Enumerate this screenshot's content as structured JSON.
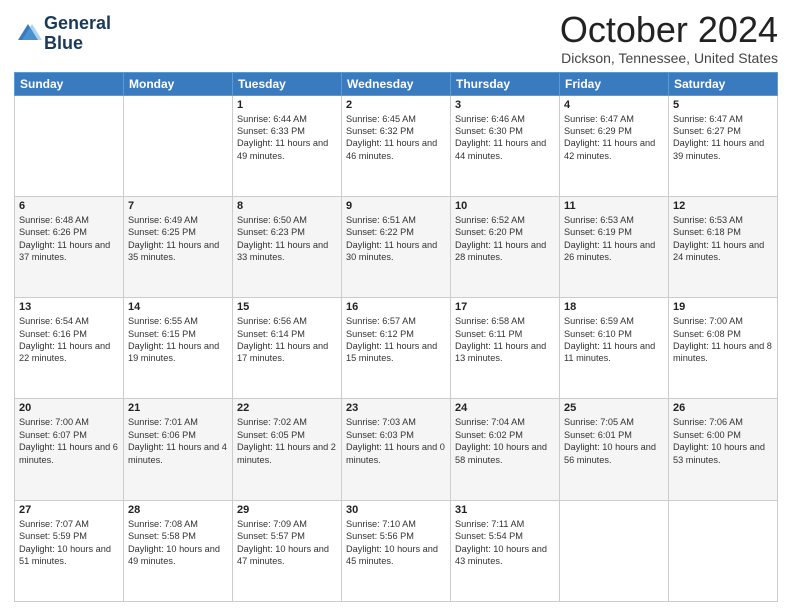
{
  "header": {
    "logo_line1": "General",
    "logo_line2": "Blue",
    "month": "October 2024",
    "location": "Dickson, Tennessee, United States"
  },
  "days_of_week": [
    "Sunday",
    "Monday",
    "Tuesday",
    "Wednesday",
    "Thursday",
    "Friday",
    "Saturday"
  ],
  "weeks": [
    [
      {
        "day": "",
        "sunrise": "",
        "sunset": "",
        "daylight": ""
      },
      {
        "day": "",
        "sunrise": "",
        "sunset": "",
        "daylight": ""
      },
      {
        "day": "1",
        "sunrise": "Sunrise: 6:44 AM",
        "sunset": "Sunset: 6:33 PM",
        "daylight": "Daylight: 11 hours and 49 minutes."
      },
      {
        "day": "2",
        "sunrise": "Sunrise: 6:45 AM",
        "sunset": "Sunset: 6:32 PM",
        "daylight": "Daylight: 11 hours and 46 minutes."
      },
      {
        "day": "3",
        "sunrise": "Sunrise: 6:46 AM",
        "sunset": "Sunset: 6:30 PM",
        "daylight": "Daylight: 11 hours and 44 minutes."
      },
      {
        "day": "4",
        "sunrise": "Sunrise: 6:47 AM",
        "sunset": "Sunset: 6:29 PM",
        "daylight": "Daylight: 11 hours and 42 minutes."
      },
      {
        "day": "5",
        "sunrise": "Sunrise: 6:47 AM",
        "sunset": "Sunset: 6:27 PM",
        "daylight": "Daylight: 11 hours and 39 minutes."
      }
    ],
    [
      {
        "day": "6",
        "sunrise": "Sunrise: 6:48 AM",
        "sunset": "Sunset: 6:26 PM",
        "daylight": "Daylight: 11 hours and 37 minutes."
      },
      {
        "day": "7",
        "sunrise": "Sunrise: 6:49 AM",
        "sunset": "Sunset: 6:25 PM",
        "daylight": "Daylight: 11 hours and 35 minutes."
      },
      {
        "day": "8",
        "sunrise": "Sunrise: 6:50 AM",
        "sunset": "Sunset: 6:23 PM",
        "daylight": "Daylight: 11 hours and 33 minutes."
      },
      {
        "day": "9",
        "sunrise": "Sunrise: 6:51 AM",
        "sunset": "Sunset: 6:22 PM",
        "daylight": "Daylight: 11 hours and 30 minutes."
      },
      {
        "day": "10",
        "sunrise": "Sunrise: 6:52 AM",
        "sunset": "Sunset: 6:20 PM",
        "daylight": "Daylight: 11 hours and 28 minutes."
      },
      {
        "day": "11",
        "sunrise": "Sunrise: 6:53 AM",
        "sunset": "Sunset: 6:19 PM",
        "daylight": "Daylight: 11 hours and 26 minutes."
      },
      {
        "day": "12",
        "sunrise": "Sunrise: 6:53 AM",
        "sunset": "Sunset: 6:18 PM",
        "daylight": "Daylight: 11 hours and 24 minutes."
      }
    ],
    [
      {
        "day": "13",
        "sunrise": "Sunrise: 6:54 AM",
        "sunset": "Sunset: 6:16 PM",
        "daylight": "Daylight: 11 hours and 22 minutes."
      },
      {
        "day": "14",
        "sunrise": "Sunrise: 6:55 AM",
        "sunset": "Sunset: 6:15 PM",
        "daylight": "Daylight: 11 hours and 19 minutes."
      },
      {
        "day": "15",
        "sunrise": "Sunrise: 6:56 AM",
        "sunset": "Sunset: 6:14 PM",
        "daylight": "Daylight: 11 hours and 17 minutes."
      },
      {
        "day": "16",
        "sunrise": "Sunrise: 6:57 AM",
        "sunset": "Sunset: 6:12 PM",
        "daylight": "Daylight: 11 hours and 15 minutes."
      },
      {
        "day": "17",
        "sunrise": "Sunrise: 6:58 AM",
        "sunset": "Sunset: 6:11 PM",
        "daylight": "Daylight: 11 hours and 13 minutes."
      },
      {
        "day": "18",
        "sunrise": "Sunrise: 6:59 AM",
        "sunset": "Sunset: 6:10 PM",
        "daylight": "Daylight: 11 hours and 11 minutes."
      },
      {
        "day": "19",
        "sunrise": "Sunrise: 7:00 AM",
        "sunset": "Sunset: 6:08 PM",
        "daylight": "Daylight: 11 hours and 8 minutes."
      }
    ],
    [
      {
        "day": "20",
        "sunrise": "Sunrise: 7:00 AM",
        "sunset": "Sunset: 6:07 PM",
        "daylight": "Daylight: 11 hours and 6 minutes."
      },
      {
        "day": "21",
        "sunrise": "Sunrise: 7:01 AM",
        "sunset": "Sunset: 6:06 PM",
        "daylight": "Daylight: 11 hours and 4 minutes."
      },
      {
        "day": "22",
        "sunrise": "Sunrise: 7:02 AM",
        "sunset": "Sunset: 6:05 PM",
        "daylight": "Daylight: 11 hours and 2 minutes."
      },
      {
        "day": "23",
        "sunrise": "Sunrise: 7:03 AM",
        "sunset": "Sunset: 6:03 PM",
        "daylight": "Daylight: 11 hours and 0 minutes."
      },
      {
        "day": "24",
        "sunrise": "Sunrise: 7:04 AM",
        "sunset": "Sunset: 6:02 PM",
        "daylight": "Daylight: 10 hours and 58 minutes."
      },
      {
        "day": "25",
        "sunrise": "Sunrise: 7:05 AM",
        "sunset": "Sunset: 6:01 PM",
        "daylight": "Daylight: 10 hours and 56 minutes."
      },
      {
        "day": "26",
        "sunrise": "Sunrise: 7:06 AM",
        "sunset": "Sunset: 6:00 PM",
        "daylight": "Daylight: 10 hours and 53 minutes."
      }
    ],
    [
      {
        "day": "27",
        "sunrise": "Sunrise: 7:07 AM",
        "sunset": "Sunset: 5:59 PM",
        "daylight": "Daylight: 10 hours and 51 minutes."
      },
      {
        "day": "28",
        "sunrise": "Sunrise: 7:08 AM",
        "sunset": "Sunset: 5:58 PM",
        "daylight": "Daylight: 10 hours and 49 minutes."
      },
      {
        "day": "29",
        "sunrise": "Sunrise: 7:09 AM",
        "sunset": "Sunset: 5:57 PM",
        "daylight": "Daylight: 10 hours and 47 minutes."
      },
      {
        "day": "30",
        "sunrise": "Sunrise: 7:10 AM",
        "sunset": "Sunset: 5:56 PM",
        "daylight": "Daylight: 10 hours and 45 minutes."
      },
      {
        "day": "31",
        "sunrise": "Sunrise: 7:11 AM",
        "sunset": "Sunset: 5:54 PM",
        "daylight": "Daylight: 10 hours and 43 minutes."
      },
      {
        "day": "",
        "sunrise": "",
        "sunset": "",
        "daylight": ""
      },
      {
        "day": "",
        "sunrise": "",
        "sunset": "",
        "daylight": ""
      }
    ]
  ]
}
